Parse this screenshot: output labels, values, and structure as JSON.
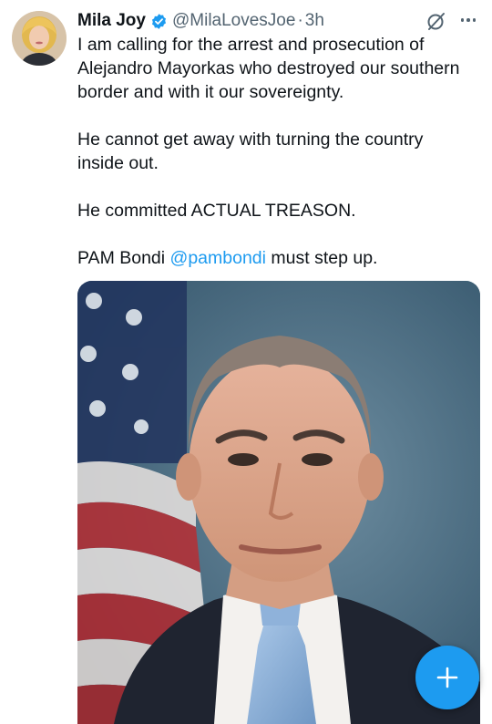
{
  "tweet": {
    "author": {
      "display_name": "Mila Joy",
      "handle": "@MilaLovesJoe",
      "verified": true,
      "verified_icon": "verified-badge-icon",
      "avatar_icon": "avatar"
    },
    "separator": "·",
    "timestamp": "3h",
    "header_icons": [
      "grok-icon",
      "more-options-icon"
    ],
    "text": {
      "line1": "I am calling for the arrest and prosecution of Alejandro Mayorkas who destroyed our southern border and with it our sovereignty.",
      "line2": "He cannot get away with turning the country inside out.",
      "line3": "He committed ACTUAL TREASON.",
      "line4_before": "PAM Bondi ",
      "line4_mention": "@pambondi",
      "line4_after": " must step up."
    },
    "media": {
      "type": "photo",
      "description_icon": "portrait-photo"
    }
  },
  "compose_button": {
    "icon": "plus-icon"
  },
  "colors": {
    "text": "#0f1419",
    "secondary": "#536471",
    "accent": "#1d9bf0",
    "background": "#ffffff"
  }
}
